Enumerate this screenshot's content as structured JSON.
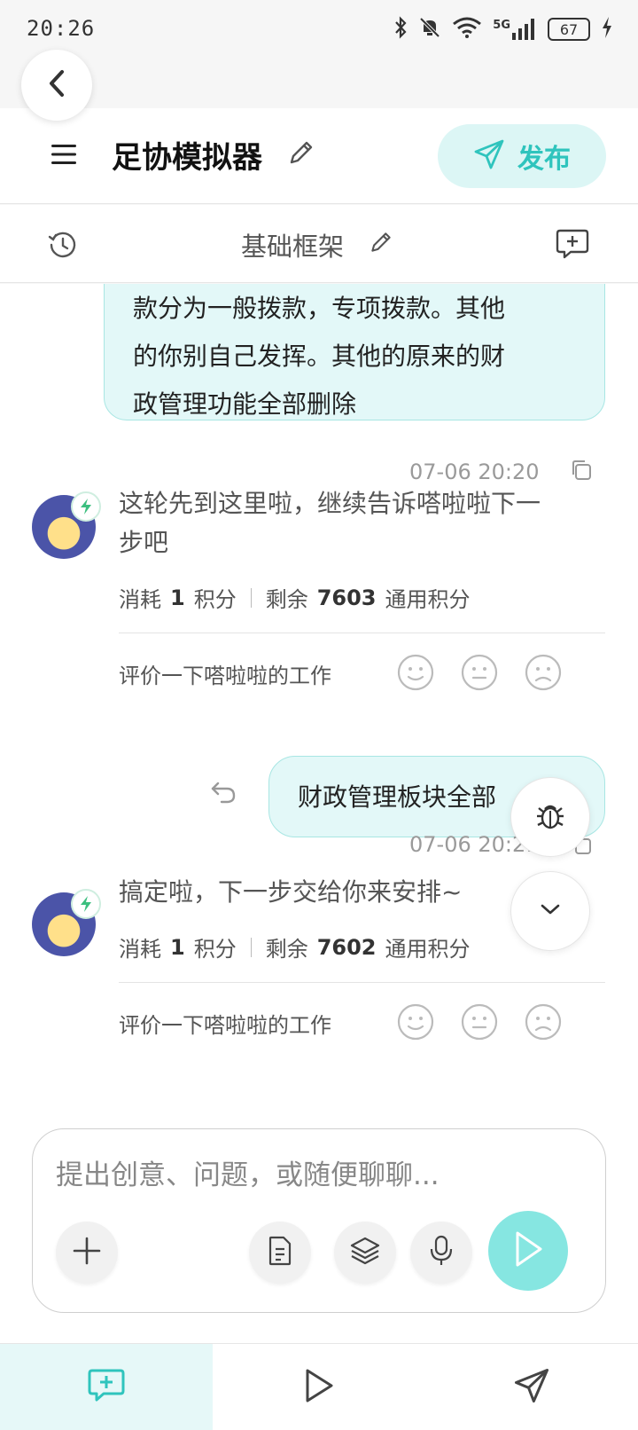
{
  "status_bar": {
    "time": "20:26",
    "network": "5G",
    "battery": "67"
  },
  "header": {
    "title": "足协模拟器",
    "publish_label": "发布"
  },
  "sub_header": {
    "title": "基础框架"
  },
  "messages": [
    {
      "role": "user",
      "text_lines": [
        "款分为一般拨款，专项拨款。其他",
        "的你别自己发挥。其他的原来的财",
        "政管理功能全部删除"
      ],
      "timestamp": "07-06 20:20"
    },
    {
      "role": "bot",
      "text_lines": [
        "这轮先到这里啦，继续告诉嗒啦啦下一",
        "步吧"
      ],
      "credits": {
        "spent_prefix": "消耗",
        "spent": "1",
        "spent_unit": "积分",
        "remaining_prefix": "剩余",
        "remaining": "7603",
        "remaining_unit": "通用积分"
      },
      "rating_prompt": "评价一下嗒啦啦的工作"
    },
    {
      "role": "user",
      "text": "财政管理板块全部",
      "timestamp": "07-06 20:21"
    },
    {
      "role": "bot",
      "text": "搞定啦，下一步交给你来安排~",
      "credits": {
        "spent_prefix": "消耗",
        "spent": "1",
        "spent_unit": "积分",
        "remaining_prefix": "剩余",
        "remaining": "7602",
        "remaining_unit": "通用积分"
      },
      "rating_prompt": "评价一下嗒啦啦的工作"
    }
  ],
  "composer": {
    "placeholder": "提出创意、问题，或随便聊聊..."
  },
  "colors": {
    "accent": "#2fc4bd",
    "bubble_bg": "#e3f8f8",
    "send_bg": "#86e6e1"
  }
}
